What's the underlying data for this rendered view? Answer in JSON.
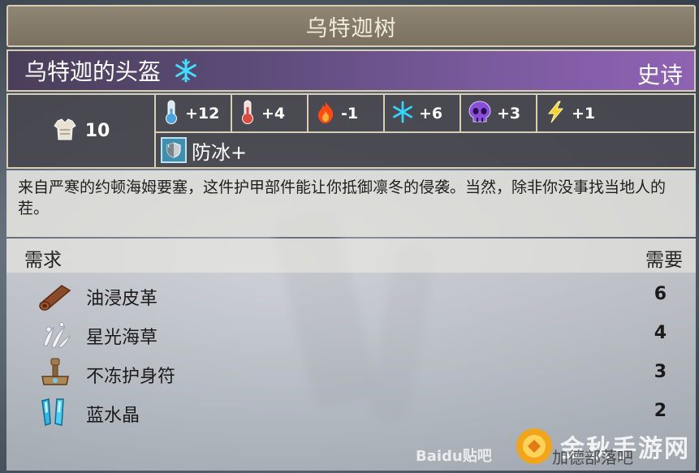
{
  "window": {
    "title": "乌特迦树"
  },
  "item": {
    "name": "乌特迦的头盔",
    "rarity": "史诗",
    "name_icon": "snowflake-icon"
  },
  "stats": {
    "armor": {
      "icon": "armor-icon",
      "value": "10"
    },
    "resistances": [
      {
        "icon": "cold-thermometer-icon",
        "value": "+12",
        "color": "#4aa3e0"
      },
      {
        "icon": "hot-thermometer-icon",
        "value": "+4",
        "color": "#e04a3a"
      },
      {
        "icon": "fire-icon",
        "value": "-1",
        "color": "#ff5a1e"
      },
      {
        "icon": "frost-icon",
        "value": "+6",
        "color": "#35d4ff"
      },
      {
        "icon": "poison-skull-icon",
        "value": "+3",
        "color": "#8a4fd8"
      },
      {
        "icon": "lightning-icon",
        "value": "+1",
        "color": "#f5d22a"
      }
    ],
    "perk": {
      "icon": "ice-resist-icon",
      "label": "防冰+"
    }
  },
  "description": "来自严寒的约顿海姆要塞，这件护甲部件能让你抵御凛冬的侵袭。当然，除非你没事找当地人的茬。",
  "requirements": {
    "header_left": "需求",
    "header_right": "需要",
    "items": [
      {
        "icon": "leather-roll-icon",
        "name": "油浸皮革",
        "count": "6"
      },
      {
        "icon": "starlight-seaweed-icon",
        "name": "星光海草",
        "count": "4"
      },
      {
        "icon": "frost-amulet-icon",
        "name": "不冻护身符",
        "count": "3"
      },
      {
        "icon": "blue-crystal-icon",
        "name": "蓝水晶",
        "count": "2"
      }
    ]
  },
  "watermarks": {
    "baidu": "Baidu贴吧",
    "brand": "金秋手游网",
    "tieba": "加德部落吧"
  }
}
